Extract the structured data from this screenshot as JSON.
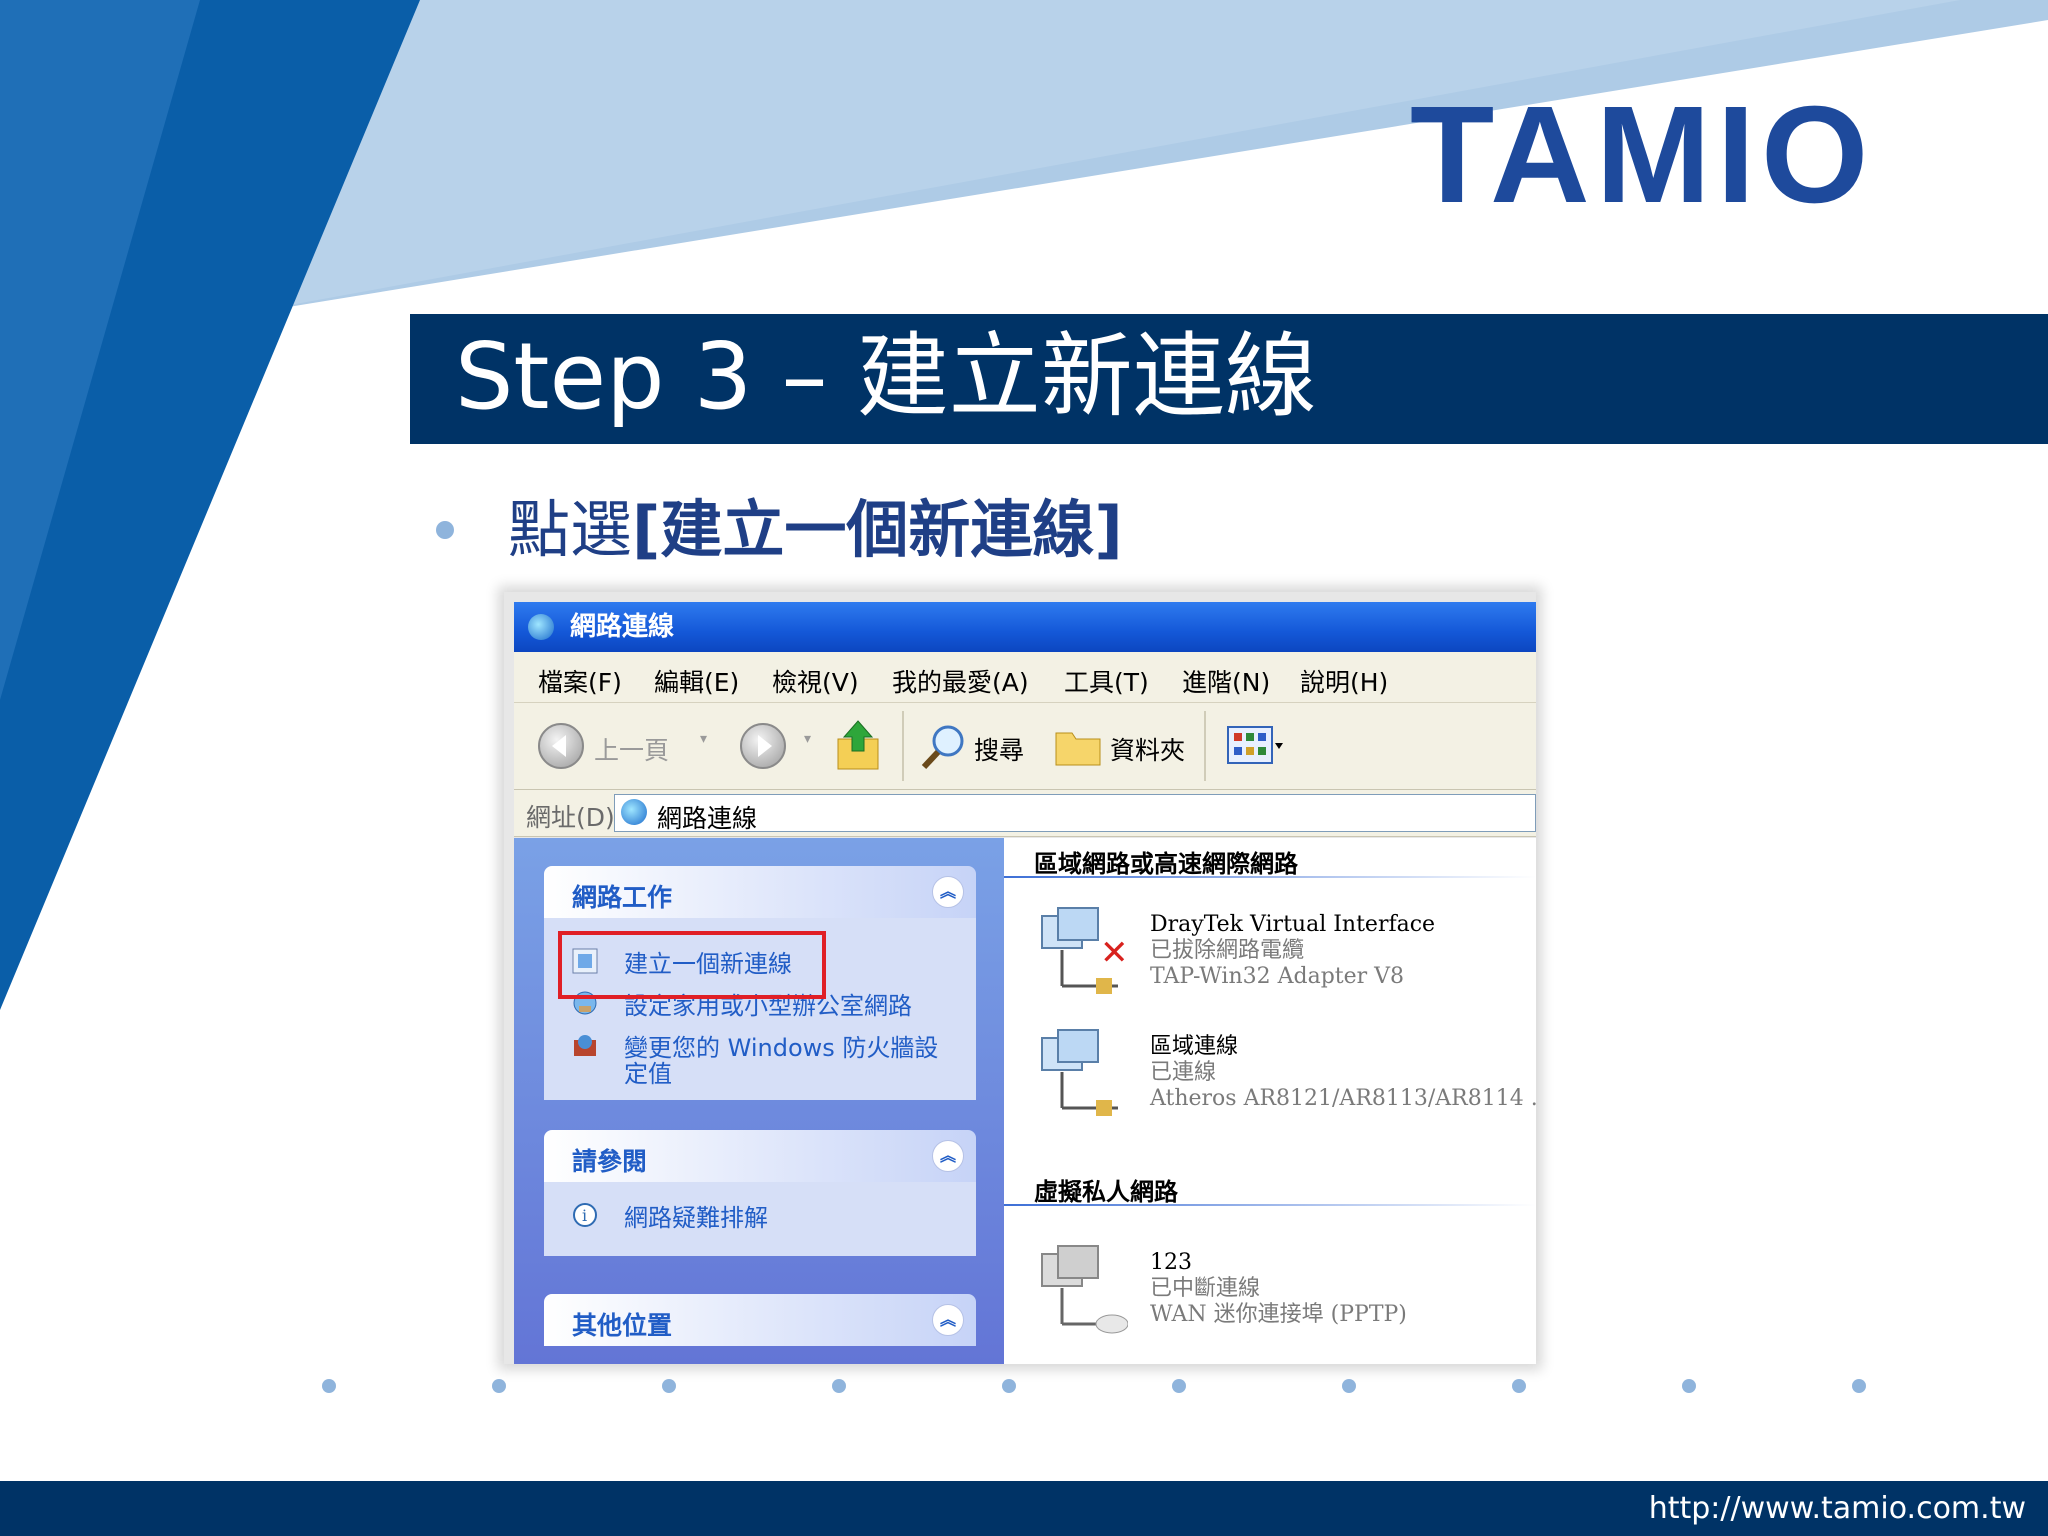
{
  "colors": {
    "brand": "#1e4a9c",
    "title_band": "#003366",
    "accent_blue": "#0066b3",
    "bullet": "#8fb4dc",
    "highlight_box": "#e01f26"
  },
  "logo": {
    "text": "TAMIO"
  },
  "slide": {
    "title": "Step 3 – 建立新連線",
    "bullet_prefix": "點選",
    "bullet_emphasis": "[建立一個新連線]",
    "footer_url": "http://www.tamio.com.tw"
  },
  "window": {
    "title": "網路連線",
    "menu": [
      "檔案(F)",
      "編輯(E)",
      "檢視(V)",
      "我的最愛(A)",
      "工具(T)",
      "進階(N)",
      "說明(H)"
    ],
    "toolbar": {
      "back": "上一頁",
      "search": "搜尋",
      "folders": "資料夾"
    },
    "address": {
      "label": "網址(D)",
      "value": "網路連線"
    },
    "tasks_panel": {
      "title": "網路工作",
      "items": [
        "建立一個新連線",
        "設定家用或小型辦公室網路",
        "變更您的 Windows 防火牆設",
        "定值"
      ]
    },
    "see_also_panel": {
      "title": "請參閱",
      "items": [
        "網路疑難排解"
      ]
    },
    "other_places_panel": {
      "title": "其他位置"
    },
    "groups": {
      "lan": "區域網路或高速網際網路",
      "vpn": "虛擬私人網路"
    },
    "connections": [
      {
        "name": "DrayTek Virtual Interface",
        "status": "已拔除網路電纜",
        "device": "TAP-Win32 Adapter V8",
        "icon": "network-disconnected-icon"
      },
      {
        "name": "區域連線",
        "status": "已連線",
        "device": "Atheros AR8121/AR8113/AR8114 ...",
        "icon": "network-connected-icon"
      },
      {
        "name": "123",
        "status": "已中斷連線",
        "device": "WAN 迷你連接埠 (PPTP)",
        "icon": "vpn-icon"
      }
    ]
  }
}
